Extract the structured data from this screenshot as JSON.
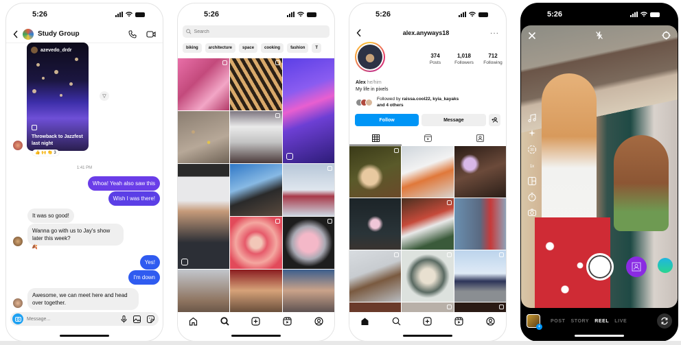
{
  "status_bar": {
    "time": "5:26"
  },
  "dm": {
    "title": "Study Group",
    "shared_post": {
      "username": "azevedo_drdr",
      "caption": "Throwback to Jazzfest last night",
      "reactions": "👍 🙌 👏 3"
    },
    "timestamp": "1:41 PM",
    "messages": [
      {
        "dir": "out",
        "text": "Whoa! Yeah also saw this",
        "color": "#6a3de8"
      },
      {
        "dir": "out",
        "text": "Wish I was there!",
        "color": "#5b3fe6"
      },
      {
        "dir": "in",
        "text": "It was so good!"
      },
      {
        "dir": "in",
        "text": "Wanna go with us to Jay's show later this week?"
      },
      {
        "dir": "out",
        "text": "Yes!",
        "color": "#2f5bf0"
      },
      {
        "dir": "out",
        "text": "I'm down",
        "color": "#2f5bf0"
      },
      {
        "dir": "in",
        "text": "Awesome, we can meet here and head over together."
      }
    ],
    "input_placeholder": "Message...",
    "reaction_emoji": "🍂"
  },
  "explore": {
    "search_placeholder": "Search",
    "chips": [
      "biking",
      "architecture",
      "space",
      "cooking",
      "fashion",
      "T"
    ]
  },
  "profile": {
    "username": "alex.anyways18",
    "stats": [
      {
        "value": "374",
        "label": "Posts"
      },
      {
        "value": "1,018",
        "label": "Followers"
      },
      {
        "value": "712",
        "label": "Following"
      }
    ],
    "name": "Alex",
    "pronouns": "he/him",
    "bio": "My life in pixels",
    "followed_by_prefix": "Followed by ",
    "followed_by_users": "raissa.cool22, kyia_kayaks",
    "followed_by_suffix": "and 4 others",
    "follow_label": "Follow",
    "message_label": "Message",
    "add_user_label": "+"
  },
  "camera": {
    "modes": [
      {
        "label": "POST",
        "active": false
      },
      {
        "label": "STORY",
        "active": false
      },
      {
        "label": "REEL",
        "active": true
      },
      {
        "label": "LIVE",
        "active": false
      }
    ],
    "side_tools": [
      "music-icon",
      "effects-icon",
      "speed-icon",
      "speed-label-icon",
      "layout-icon",
      "timer-icon",
      "camera-icon"
    ]
  },
  "colors": {
    "accent_blue": "#0095f6",
    "dm_purple": "#6a3de8",
    "dm_blue": "#2f5bf0"
  }
}
